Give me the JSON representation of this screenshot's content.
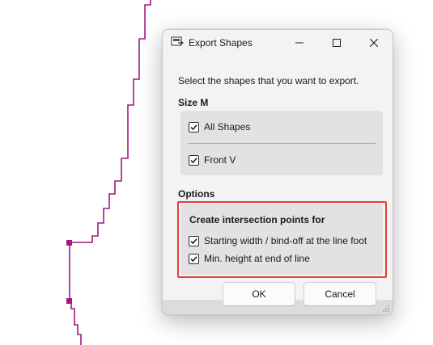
{
  "background": {
    "stroke_color": "#a0197f"
  },
  "dialog": {
    "title": "Export Shapes",
    "icon": "export-shapes-icon",
    "window_controls": {
      "minimize": "minimize-icon",
      "maximize": "maximize-icon",
      "close": "close-icon"
    },
    "instruction": "Select the shapes that you want to export.",
    "size_section": {
      "title": "Size M",
      "items": [
        {
          "label": "All Shapes",
          "checked": true
        },
        {
          "label": "Front V",
          "checked": true
        }
      ]
    },
    "options_section": {
      "title": "Options",
      "heading": "Create intersection points for",
      "items": [
        {
          "label": "Starting width / bind-off at the line foot",
          "checked": true
        },
        {
          "label": "Min. height at end of line",
          "checked": true
        }
      ]
    },
    "buttons": {
      "ok": "OK",
      "cancel": "Cancel"
    },
    "highlight_color": "#e0403c"
  }
}
